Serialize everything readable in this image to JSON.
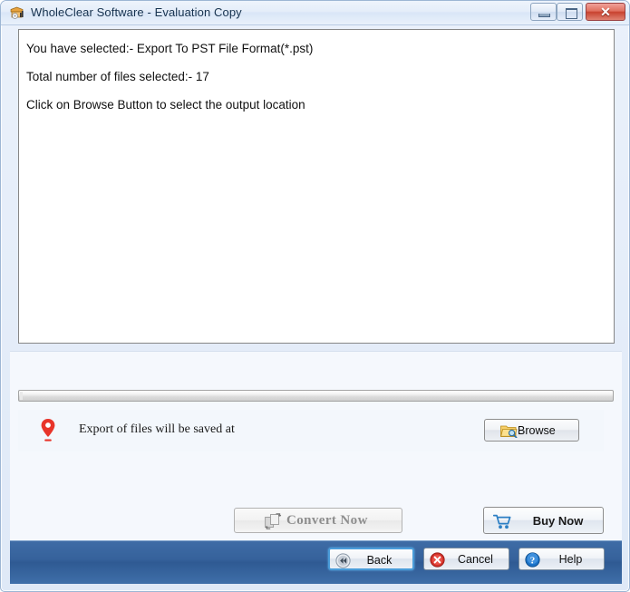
{
  "window": {
    "title": "WholeClear Software - Evaluation Copy",
    "icon": "app-icon",
    "controls": {
      "minimize": "minimize-icon",
      "maximize": "maximize-icon",
      "close": "✕"
    }
  },
  "content": {
    "lines": [
      "You have selected:- Export To PST File Format(*.pst)",
      "Total number of files selected:-  17",
      "Click on Browse Button to select the output location"
    ]
  },
  "progress": {
    "value": 0,
    "max": 100
  },
  "output": {
    "pin_icon": "location-pin-icon",
    "label": "Export of files will be saved at",
    "path_value": "",
    "browse_label": "Browse",
    "browse_icon": "folder-search-icon"
  },
  "actions": {
    "convert_label": "Convert Now",
    "convert_icon": "convert-pages-icon",
    "convert_disabled": true,
    "buy_label": "Buy Now",
    "buy_icon": "shopping-cart-icon"
  },
  "footer": {
    "back_label": "Back",
    "back_icon": "rewind-icon",
    "cancel_label": "Cancel",
    "cancel_icon": "cancel-x-icon",
    "help_label": "Help",
    "help_icon": "question-mark-icon"
  },
  "colors": {
    "footer_blue": "#36629b",
    "accent_focus": "#4a9cd9",
    "pin_red": "#e8342a",
    "cancel_red": "#d6322a",
    "help_blue": "#1a72c8",
    "cart_blue": "#2c7fc4",
    "folder_yellow": "#f5c242"
  }
}
